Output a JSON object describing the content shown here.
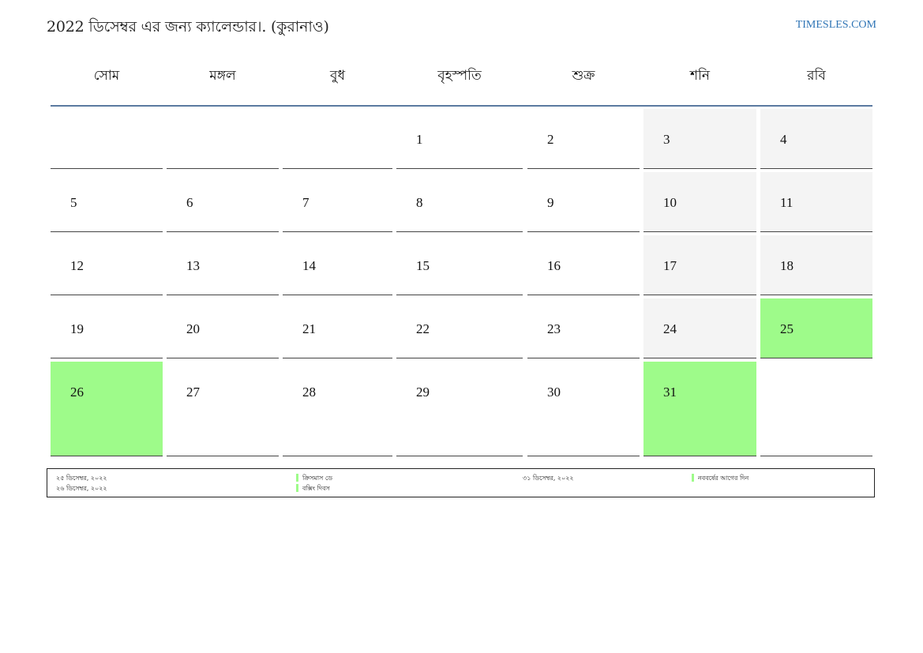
{
  "header": {
    "title": "2022 ডিসেম্বর এর জন্য ক্যালেন্ডার।. (কুরানাও)",
    "site": "TIMESLES.COM"
  },
  "calendar": {
    "weekdays": [
      "সোম",
      "মঙ্গল",
      "বুধ",
      "বৃহস্পতি",
      "শুক্র",
      "শনি",
      "রবি"
    ],
    "weeks": [
      [
        {
          "day": "",
          "type": "empty"
        },
        {
          "day": "",
          "type": "empty"
        },
        {
          "day": "",
          "type": "empty"
        },
        {
          "day": "1",
          "type": "normal"
        },
        {
          "day": "2",
          "type": "normal"
        },
        {
          "day": "3",
          "type": "weekend"
        },
        {
          "day": "4",
          "type": "weekend"
        }
      ],
      [
        {
          "day": "5",
          "type": "normal"
        },
        {
          "day": "6",
          "type": "normal"
        },
        {
          "day": "7",
          "type": "normal"
        },
        {
          "day": "8",
          "type": "normal"
        },
        {
          "day": "9",
          "type": "normal"
        },
        {
          "day": "10",
          "type": "weekend"
        },
        {
          "day": "11",
          "type": "weekend"
        }
      ],
      [
        {
          "day": "12",
          "type": "normal"
        },
        {
          "day": "13",
          "type": "normal"
        },
        {
          "day": "14",
          "type": "normal"
        },
        {
          "day": "15",
          "type": "normal"
        },
        {
          "day": "16",
          "type": "normal"
        },
        {
          "day": "17",
          "type": "weekend"
        },
        {
          "day": "18",
          "type": "weekend"
        }
      ],
      [
        {
          "day": "19",
          "type": "normal"
        },
        {
          "day": "20",
          "type": "normal"
        },
        {
          "day": "21",
          "type": "normal"
        },
        {
          "day": "22",
          "type": "normal"
        },
        {
          "day": "23",
          "type": "normal"
        },
        {
          "day": "24",
          "type": "weekend"
        },
        {
          "day": "25",
          "type": "holiday"
        }
      ],
      [
        {
          "day": "26",
          "type": "holiday"
        },
        {
          "day": "27",
          "type": "normal"
        },
        {
          "day": "28",
          "type": "normal"
        },
        {
          "day": "29",
          "type": "normal"
        },
        {
          "day": "30",
          "type": "normal"
        },
        {
          "day": "31",
          "type": "holiday"
        },
        {
          "day": "",
          "type": "empty"
        }
      ]
    ]
  },
  "legend": {
    "holiday_color": "#9efb8a",
    "weekend_color": "#f4f4f4",
    "items": [
      {
        "date": "২৫ ডিসেম্বর, ২০২২",
        "name": "ক্রিসমাস ডে"
      },
      {
        "date": "২৬ ডিসেম্বর, ২০২২",
        "name": "বক্সিং দিবস"
      },
      {
        "date": "৩১ ডিসেম্বর, ২০২২",
        "name": "নববর্ষের আগের দিন"
      }
    ]
  }
}
